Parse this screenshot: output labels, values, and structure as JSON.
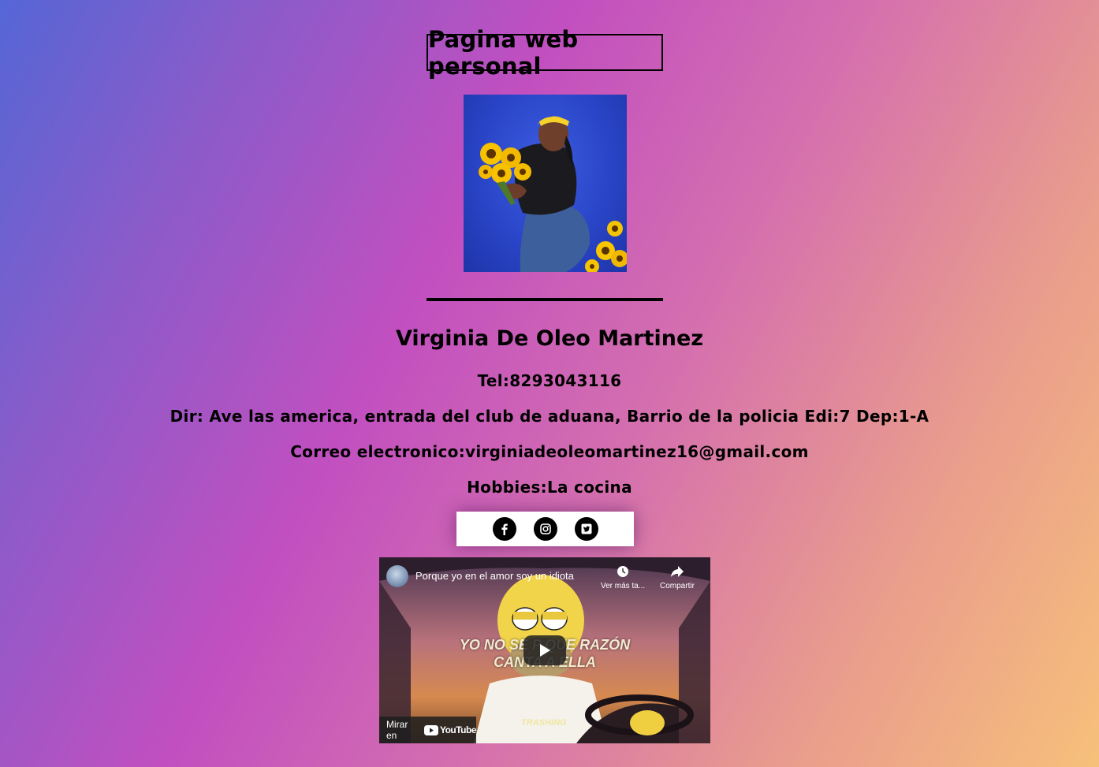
{
  "header": {
    "title": "Pagina web personal"
  },
  "profile": {
    "name": "Virginia De Oleo Martinez",
    "phone": "Tel:8293043116",
    "address": "Dir: Ave las america, entrada del club de aduana, Barrio de la policia Edi:7 Dep:1-A",
    "email": "Correo electronico:virginiadeoleomartinez16@gmail.com",
    "hobbies": "Hobbies:La cocina"
  },
  "social": [
    {
      "icon": "facebook-icon"
    },
    {
      "icon": "instagram-icon"
    },
    {
      "icon": "twitter-icon"
    }
  ],
  "video": {
    "title": "Porque yo en el amor soy un idiota",
    "watch_later": "Ver más ta...",
    "share": "Compartir",
    "caption_line1": "YO NO SE P   QUE RAZÓN",
    "caption_line2": "CANTA     A ELLA",
    "watermark": "TRASHING",
    "watch_on": "Mirar en",
    "youtube": "YouTube"
  },
  "colors": {
    "gradient_start": "#5566d6",
    "gradient_mid": "#c24fc0",
    "gradient_end": "#f7c07a"
  }
}
